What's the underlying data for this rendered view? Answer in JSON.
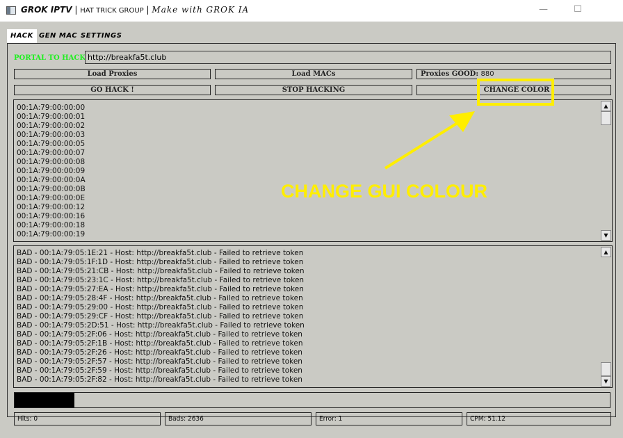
{
  "window": {
    "title_main": "GROK IPTV",
    "title_group": "HAT TRICK GROUP",
    "title_tag": "Make with GROK IA",
    "sep": "|",
    "minimize": "—",
    "maximize": "☐"
  },
  "tabs": [
    {
      "label": "HACK",
      "active": true
    },
    {
      "label": "GEN MAC"
    },
    {
      "label": "SETTINGS"
    }
  ],
  "portal": {
    "label": "PORTAL TO HACK:",
    "value": "http://breakfa5t.club"
  },
  "buttons": {
    "load_proxies": "Load Proxies",
    "load_macs": "Load MACs",
    "go_hack": "GO HACK !",
    "stop": "STOP HACKING",
    "change_color": "CHANGE COLOR"
  },
  "proxies": {
    "label": "Proxies GOOD:",
    "value": "880"
  },
  "mac_list": [
    "00:1A:79:00:00:00",
    "00:1A:79:00:00:01",
    "00:1A:79:00:00:02",
    "00:1A:79:00:00:03",
    "00:1A:79:00:00:05",
    "00:1A:79:00:00:07",
    "00:1A:79:00:00:08",
    "00:1A:79:00:00:09",
    "00:1A:79:00:00:0A",
    "00:1A:79:00:00:0B",
    "00:1A:79:00:00:0E",
    "00:1A:79:00:00:12",
    "00:1A:79:00:00:16",
    "00:1A:79:00:00:18",
    "00:1A:79:00:00:19"
  ],
  "log": [
    "BAD - 00:1A:79:05:1E:21 - Host: http://breakfa5t.club - Failed to retrieve token",
    "BAD - 00:1A:79:05:1F:1D - Host: http://breakfa5t.club - Failed to retrieve token",
    "BAD - 00:1A:79:05:21:CB - Host: http://breakfa5t.club - Failed to retrieve token",
    "BAD - 00:1A:79:05:23:1C - Host: http://breakfa5t.club - Failed to retrieve token",
    "BAD - 00:1A:79:05:27:EA - Host: http://breakfa5t.club - Failed to retrieve token",
    "BAD - 00:1A:79:05:28:4F - Host: http://breakfa5t.club - Failed to retrieve token",
    "BAD - 00:1A:79:05:29:00 - Host: http://breakfa5t.club - Failed to retrieve token",
    "BAD - 00:1A:79:05:29:CF - Host: http://breakfa5t.club - Failed to retrieve token",
    "BAD - 00:1A:79:05:2D:51 - Host: http://breakfa5t.club - Failed to retrieve token",
    "BAD - 00:1A:79:05:2F:06 - Host: http://breakfa5t.club - Failed to retrieve token",
    "BAD - 00:1A:79:05:2F:1B - Host: http://breakfa5t.club - Failed to retrieve token",
    "BAD - 00:1A:79:05:2F:26 - Host: http://breakfa5t.club - Failed to retrieve token",
    "BAD - 00:1A:79:05:2F:57 - Host: http://breakfa5t.club - Failed to retrieve token",
    "BAD - 00:1A:79:05:2F:59 - Host: http://breakfa5t.club - Failed to retrieve token",
    "BAD - 00:1A:79:05:2F:82 - Host: http://breakfa5t.club - Failed to retrieve token"
  ],
  "progress_percent": 10,
  "stats": {
    "hits": "Hits: 0",
    "bads": "Bads: 2636",
    "error": "Error: 1",
    "cpm": "CPM: 51.12"
  },
  "annotation": {
    "text": "CHANGE GUI COLOUR",
    "color": "#ffee00"
  }
}
